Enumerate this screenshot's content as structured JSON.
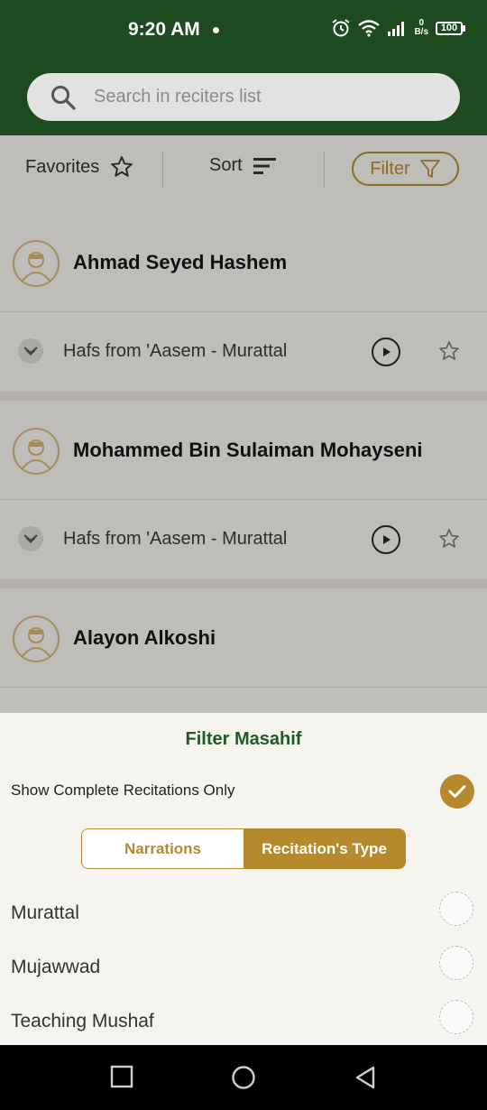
{
  "status_bar": {
    "time": "9:20 AM",
    "net_speed_value": "0",
    "net_speed_unit": "B/s",
    "battery": "100"
  },
  "search": {
    "placeholder": "Search in reciters list"
  },
  "toolbar": {
    "favorites_label": "Favorites",
    "sort_label": "Sort",
    "filter_label": "Filter"
  },
  "reciters": [
    {
      "name": "Ahmad Seyed Hashem",
      "recitation": "Hafs from 'Aasem - Murattal"
    },
    {
      "name": "Mohammed Bin Sulaiman Mohayseni",
      "recitation": "Hafs from 'Aasem - Murattal"
    },
    {
      "name": "Alayon Alkoshi"
    }
  ],
  "filter_sheet": {
    "title": "Filter Masahif",
    "complete_label": "Show Complete Recitations Only",
    "complete_checked": true,
    "tabs": [
      "Narrations",
      "Recitation's Type"
    ],
    "active_tab": "Recitation's Type",
    "options": [
      "Murattal",
      "Mujawwad",
      "Teaching Mushaf"
    ]
  },
  "colors": {
    "header_green": "#1d4a1e",
    "accent_gold": "#b5892c",
    "title_green": "#1f5c24"
  }
}
